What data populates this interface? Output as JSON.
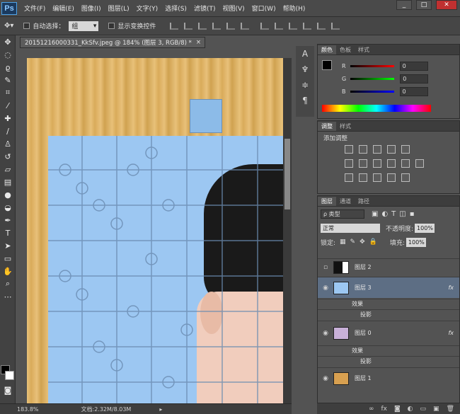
{
  "app": {
    "logo": "Ps"
  },
  "menu": [
    "文件(F)",
    "编辑(E)",
    "图像(I)",
    "图层(L)",
    "文字(Y)",
    "选择(S)",
    "滤镜(T)",
    "视图(V)",
    "窗口(W)",
    "帮助(H)"
  ],
  "window_controls": {
    "minimize": "_",
    "restore": "□",
    "close": "✕"
  },
  "options_bar": {
    "auto_select_label": "自动选择：",
    "auto_select_value": "组",
    "transform_label": "显示变换控件"
  },
  "document": {
    "tab_title": "20151216000331_KkSfv.jpeg @ 184% (图层 3, RGB/8) *",
    "tab_close": "×"
  },
  "status": {
    "zoom": "183.8%",
    "doc_size": "文档:2.32M/8.03M"
  },
  "color_panel": {
    "tabs": [
      "颜色",
      "色板",
      "样式"
    ],
    "channels": [
      {
        "label": "R",
        "value": "0",
        "color": "#d02020"
      },
      {
        "label": "G",
        "value": "0",
        "color": "#20b020"
      },
      {
        "label": "B",
        "value": "0",
        "color": "#2040d0"
      }
    ]
  },
  "adjust_panel": {
    "tabs": [
      "调整",
      "样式"
    ],
    "title": "添加调整"
  },
  "layers_panel": {
    "tabs": [
      "图层",
      "通道",
      "路径"
    ],
    "filter_label": "ρ 类型",
    "blend_mode": "正常",
    "opacity_label": "不透明度:",
    "opacity_value": "100%",
    "lock_label": "锁定:",
    "fill_label": "填充:",
    "fill_value": "100%",
    "layers": [
      {
        "name": "图层 2",
        "fx": "",
        "visible": false
      },
      {
        "name": "图层 3",
        "fx": "fx",
        "visible": true,
        "selected": true
      },
      {
        "name": "效果",
        "sub": true
      },
      {
        "name": "投影",
        "sub": true,
        "deep": true
      },
      {
        "name": "图层 0",
        "fx": "fx",
        "visible": true
      },
      {
        "name": "效果",
        "sub": true
      },
      {
        "name": "投影",
        "sub": true,
        "deep": true
      },
      {
        "name": "图层 1",
        "fx": "",
        "visible": true
      }
    ]
  }
}
